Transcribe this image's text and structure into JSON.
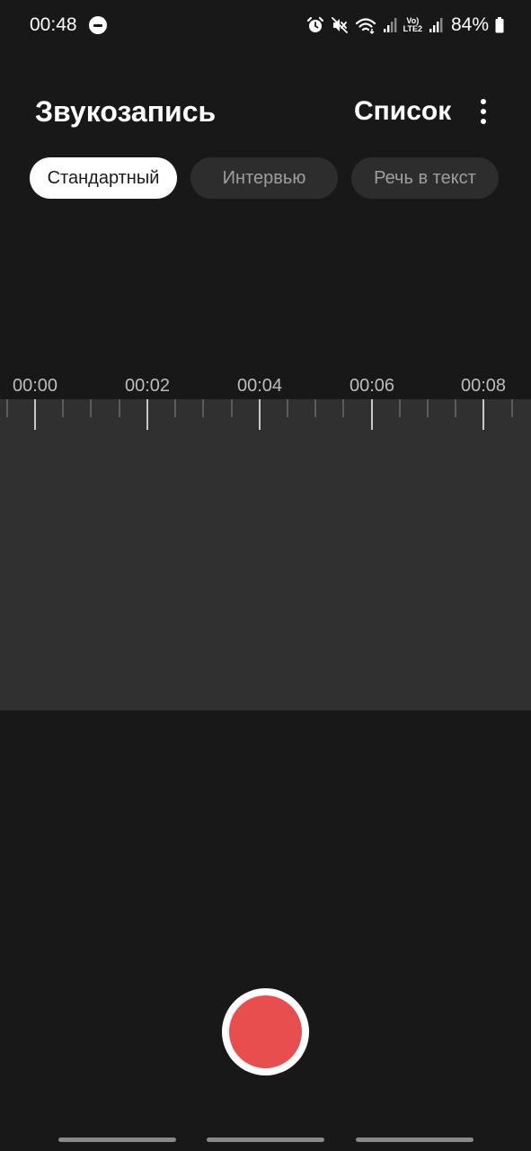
{
  "status_bar": {
    "time": "00:48",
    "network_label_top": "Vo)",
    "network_label_bottom": "LTE2",
    "battery": "84%",
    "icons": [
      "do-not-disturb-icon",
      "alarm-icon",
      "mute-icon",
      "wifi-icon",
      "signal-icon",
      "volte-icon",
      "signal-icon",
      "battery-icon"
    ]
  },
  "header": {
    "title": "Звукозапись",
    "list_label": "Список",
    "more_icon": "more-vert-icon"
  },
  "mode_tabs": [
    {
      "label": "Стандартный",
      "selected": true
    },
    {
      "label": "Интервью",
      "selected": false
    },
    {
      "label": "Речь в текст",
      "selected": false
    }
  ],
  "timeline": {
    "labels": [
      "00:00",
      "00:02",
      "00:04",
      "00:06",
      "00:08"
    ]
  },
  "record": {
    "icon": "record-icon",
    "color": "#e84e4e"
  },
  "colors": {
    "background": "#181818",
    "waveform_background": "#303030",
    "tab_active_bg": "#ffffff",
    "tab_inactive_bg": "#2d2d2d"
  }
}
